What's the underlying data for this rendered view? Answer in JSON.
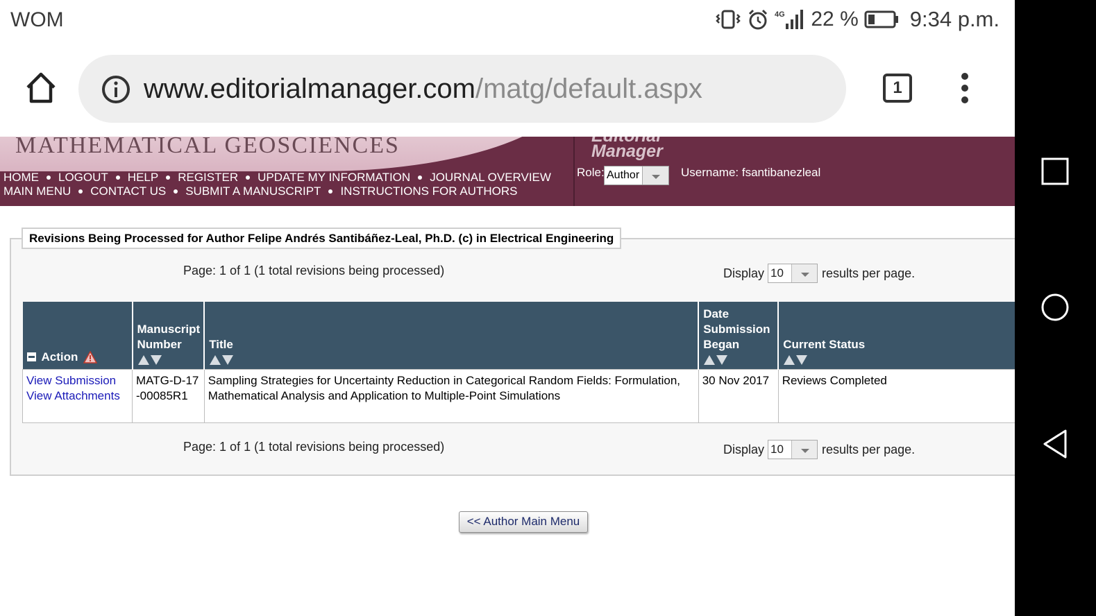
{
  "status_bar": {
    "carrier": "WOM",
    "network": "4G",
    "battery_percent": "22 %",
    "time": "9:34 p.m."
  },
  "browser": {
    "url_host": "www.editorialmanager.com",
    "url_path": "/matg/default.aspx",
    "tab_count": "1"
  },
  "site": {
    "journal_title": "MATHEMATICAL GEOSCIENCES",
    "logo_line1": "Editorial",
    "logo_line2": "Manager",
    "nav_row1": [
      "HOME",
      "LOGOUT",
      "HELP",
      "REGISTER",
      "UPDATE MY INFORMATION",
      "JOURNAL OVERVIEW"
    ],
    "nav_row2": [
      "MAIN MENU",
      "CONTACT US",
      "SUBMIT A MANUSCRIPT",
      "INSTRUCTIONS FOR AUTHORS"
    ],
    "role_label": "Role:",
    "role_value": "Author",
    "username": "Username: fsantibanezleal"
  },
  "panel": {
    "legend": "Revisions Being Processed for Author Felipe Andrés Santibáñez-Leal, Ph.D. (c) in Electrical Engineering",
    "pager_text": "Page: 1 of 1 (1 total revisions being processed)",
    "display_label": "Display",
    "display_value": "10",
    "results_label": "results per page."
  },
  "table": {
    "headers": {
      "action": "Action",
      "manuscript_number": "Manuscript Number",
      "title": "Title",
      "date_began": "Date Submission Began",
      "status": "Current Status"
    },
    "rows": [
      {
        "action_links": [
          "View Submission",
          "View Attachments"
        ],
        "manuscript_number": "MATG-D-17-00085R1",
        "title": "Sampling Strategies for Uncertainty Reduction in Categorical Random Fields: Formulation, Mathematical Analysis and Application to Multiple-Point Simulations",
        "date_began": "30 Nov 2017",
        "status": "Reviews Completed"
      }
    ]
  },
  "back_button": "<< Author Main Menu",
  "icons": [
    "home-icon",
    "info-icon",
    "tabs-icon",
    "more-vert-icon",
    "vibrate-icon",
    "alarm-icon",
    "signal-icon",
    "battery-icon",
    "square-icon",
    "circle-icon",
    "back-triangle-icon",
    "warning-icon",
    "sort-up-icon",
    "sort-down-icon",
    "collapse-icon"
  ],
  "colors": {
    "header_bg": "#6a2d45",
    "table_header_bg": "#3b5568",
    "link": "#1a1ab8"
  }
}
